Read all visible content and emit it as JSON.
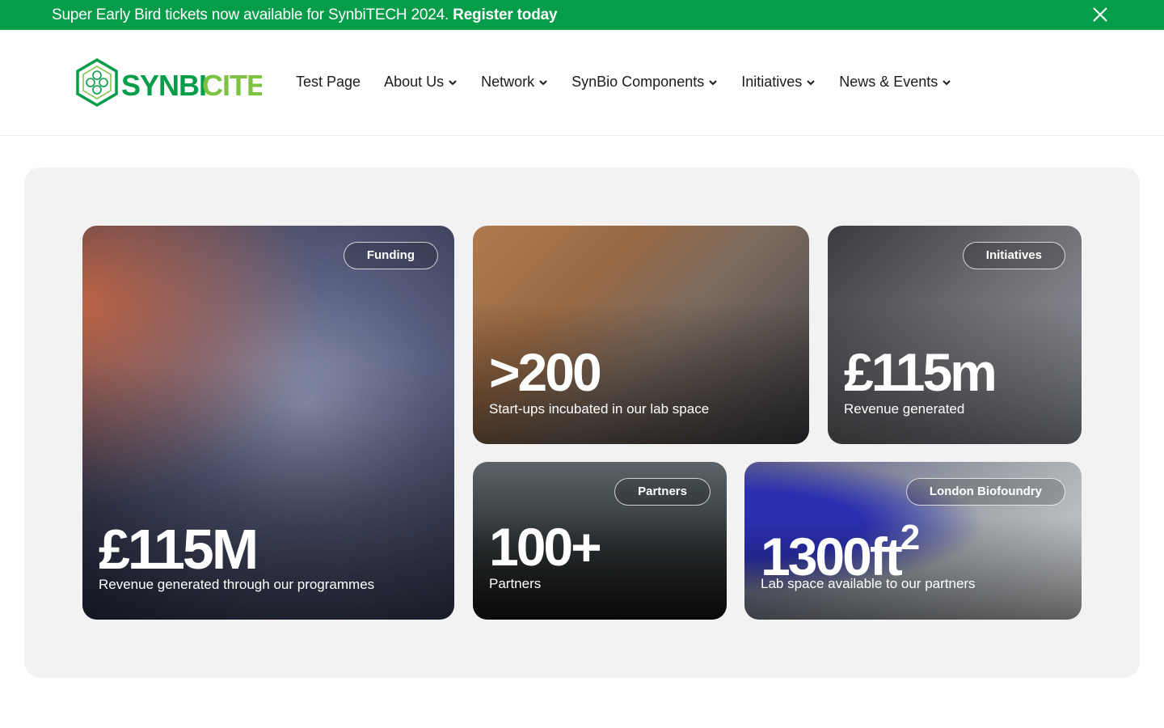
{
  "banner": {
    "text": "Super Early Bird tickets now available for SynbiTECH 2024.",
    "link": "Register today"
  },
  "brand": {
    "name": "SynbiCITE",
    "logo_text_part1": "SYNBI",
    "logo_text_part2": "CITE",
    "colors": {
      "green": "#069d4a",
      "light_green": "#7ec242"
    }
  },
  "nav": {
    "items": [
      {
        "label": "Test Page",
        "dropdown": false
      },
      {
        "label": "About Us",
        "dropdown": true
      },
      {
        "label": "Network",
        "dropdown": true
      },
      {
        "label": "SynBio Components",
        "dropdown": true
      },
      {
        "label": "Initiatives",
        "dropdown": true
      },
      {
        "label": "News & Events",
        "dropdown": true
      }
    ]
  },
  "cards": [
    {
      "tag": "Funding",
      "stat": "£115M",
      "desc": "Revenue generated through our programmes"
    },
    {
      "tag": "",
      "stat": ">200",
      "desc": "Start-ups incubated in our lab space"
    },
    {
      "tag": "Initiatives",
      "stat": "£115m",
      "desc": "Revenue generated"
    },
    {
      "tag": "Partners",
      "stat": "100+",
      "desc": "Partners"
    },
    {
      "tag": "London Biofoundry",
      "stat": "1300ft",
      "stat_sup": "2",
      "desc": "Lab space available to our partners"
    }
  ]
}
